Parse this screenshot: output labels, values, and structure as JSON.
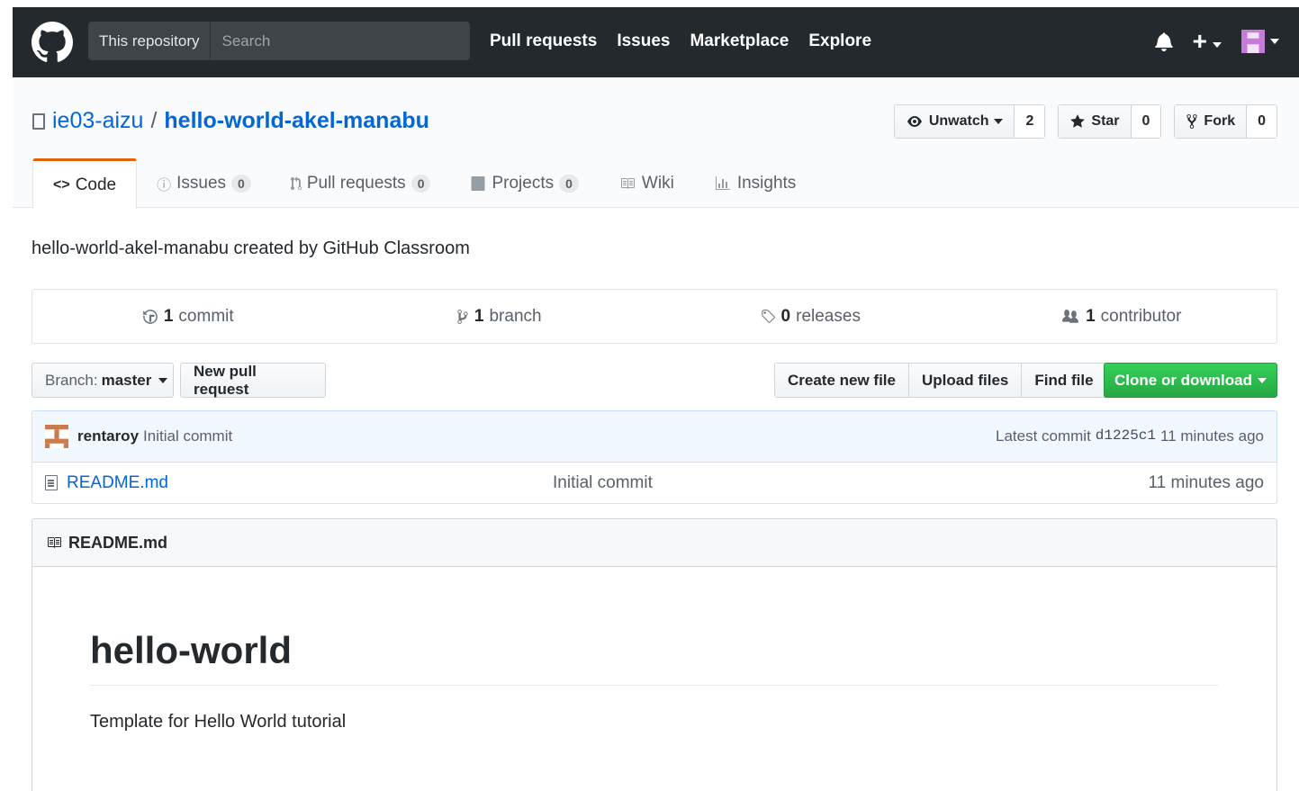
{
  "header": {
    "search_scope": "This repository",
    "search_placeholder": "Search",
    "nav": [
      "Pull requests",
      "Issues",
      "Marketplace",
      "Explore"
    ],
    "plus_label": "+"
  },
  "repo": {
    "owner": "ie03-aizu",
    "separator": "/",
    "name": "hello-world-akel-manabu",
    "watch_label": "Unwatch",
    "watch_count": "2",
    "star_label": "Star",
    "star_count": "0",
    "fork_label": "Fork",
    "fork_count": "0"
  },
  "tabs": [
    {
      "label": "Code",
      "icon": "code-icon"
    },
    {
      "label": "Issues",
      "counter": "0",
      "icon": "issue-icon"
    },
    {
      "label": "Pull requests",
      "counter": "0",
      "icon": "pr-icon"
    },
    {
      "label": "Projects",
      "counter": "0",
      "icon": "project-icon"
    },
    {
      "label": "Wiki",
      "icon": "wiki-icon"
    },
    {
      "label": "Insights",
      "icon": "graph-icon"
    }
  ],
  "description": "hello-world-akel-manabu created by GitHub Classroom",
  "summary": {
    "commits_num": "1",
    "commits_label": "commit",
    "branches_num": "1",
    "branches_label": "branch",
    "releases_num": "0",
    "releases_label": "releases",
    "contributors_num": "1",
    "contributors_label": "contributor"
  },
  "filenav": {
    "branch_prefix": "Branch:",
    "branch_name": "master",
    "new_pr": "New pull request",
    "create_file": "Create new file",
    "upload_files": "Upload files",
    "find_file": "Find file",
    "clone": "Clone or download"
  },
  "latest_commit": {
    "author": "rentaroy",
    "message": "Initial commit",
    "prefix": "Latest commit",
    "sha": "d1225c1",
    "age": "11 minutes ago"
  },
  "files": [
    {
      "name": "README.md",
      "message": "Initial commit",
      "age": "11 minutes ago"
    }
  ],
  "readme": {
    "filename": "README.md",
    "heading": "hello-world",
    "body": "Template for Hello World tutorial"
  },
  "colors": {
    "header_bg": "#24292e",
    "link": "#0366d6",
    "tab_accent": "#e36209",
    "clone_green": "#28a745"
  }
}
